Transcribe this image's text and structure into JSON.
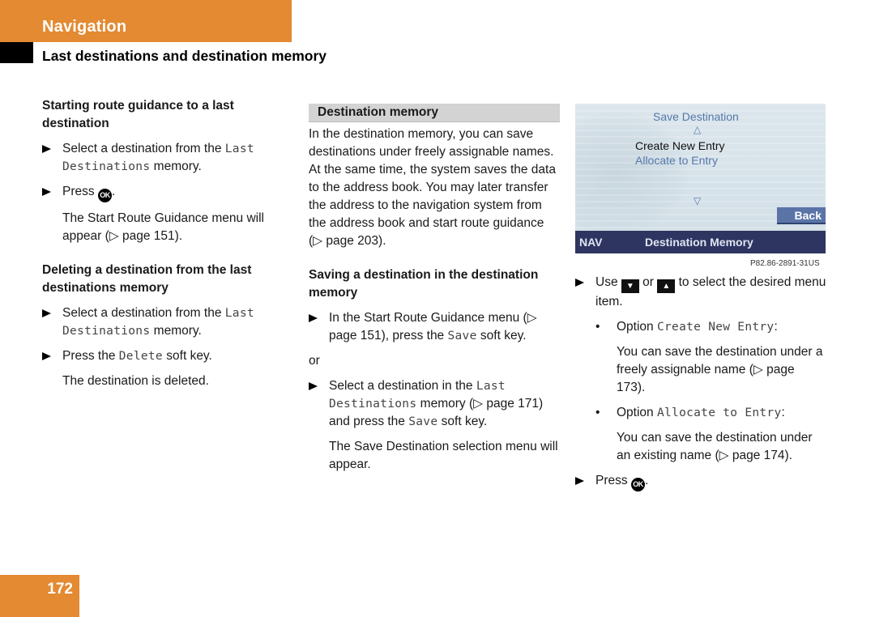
{
  "header": {
    "section_title": "Navigation",
    "subtitle": "Last destinations and destination memory"
  },
  "column1": {
    "heading1": "Starting route guidance to a last destination",
    "step1_pre": "Select a destination from the ",
    "step1_mono": "Last Destinations",
    "step1_post": " memory.",
    "step2_pre": "Press ",
    "step2_ok": "OK",
    "step2_post": ".",
    "step2_note": "The Start Route Guidance menu will appear (▷ page 151).",
    "heading2": "Deleting a destination from the last destinations memory",
    "step3_pre": "Select a destination from the ",
    "step3_mono": "Last Destinations",
    "step3_post": " memory.",
    "step4_pre": "Press the ",
    "step4_mono": "Delete",
    "step4_post": " soft key.",
    "step4_note": "The destination is deleted."
  },
  "column2": {
    "section_bar": "Destination memory",
    "para1": "In the destination memory, you can save destinations under freely assignable names.",
    "para2": "At the same time, the system saves the data to the address book. You may later transfer the address to the navigation system from the address book and start route guidance (▷ page 203).",
    "heading": "Saving a destination in the destination memory",
    "step1_pre": "In the Start Route Guidance menu (▷ page 151), press the ",
    "step1_mono": "Save",
    "step1_post": " soft key.",
    "or": "or",
    "step2_pre": "Select a destination in the ",
    "step2_mono": "Last Destinations",
    "step2_mid": " memory (▷ page 171) and press the ",
    "step2_mono2": "Save",
    "step2_post": " soft key.",
    "step2_note": "The Save Destination selection menu will appear."
  },
  "screen": {
    "title": "Save Destination",
    "up_arrow": "△",
    "items": [
      "Create New Entry",
      "Allocate to Entry"
    ],
    "selected_item": "Create New Entry",
    "down_arrow": "▽",
    "back_button": "Back",
    "bottom_left": "NAV",
    "bottom_center": "Destination Memory",
    "figure_code": "P82.86-2891-31US",
    "colors": {
      "bottom_bar": "#2e3561",
      "back_button": "#5a74a8",
      "menu_text": "#5577aa"
    }
  },
  "column3": {
    "step1_pre": "Use ",
    "key_down": "▼",
    "step1_or": " or ",
    "key_up": "▲",
    "step1_post": " to select the desired menu item.",
    "option1_pre": "Option ",
    "option1_mono": "Create New Entry",
    "option1_post": ":",
    "option1_body": "You can save the destination under a freely assignable name (▷ page 173).",
    "option2_pre": "Option ",
    "option2_mono": "Allocate to Entry",
    "option2_post": ":",
    "option2_body": "You can save the destination under an existing name (▷ page 174).",
    "step2_pre": "Press ",
    "step2_ok": "OK",
    "step2_post": "."
  },
  "footer": {
    "page_number": "172"
  },
  "colors": {
    "accent_orange": "#e38a32"
  }
}
